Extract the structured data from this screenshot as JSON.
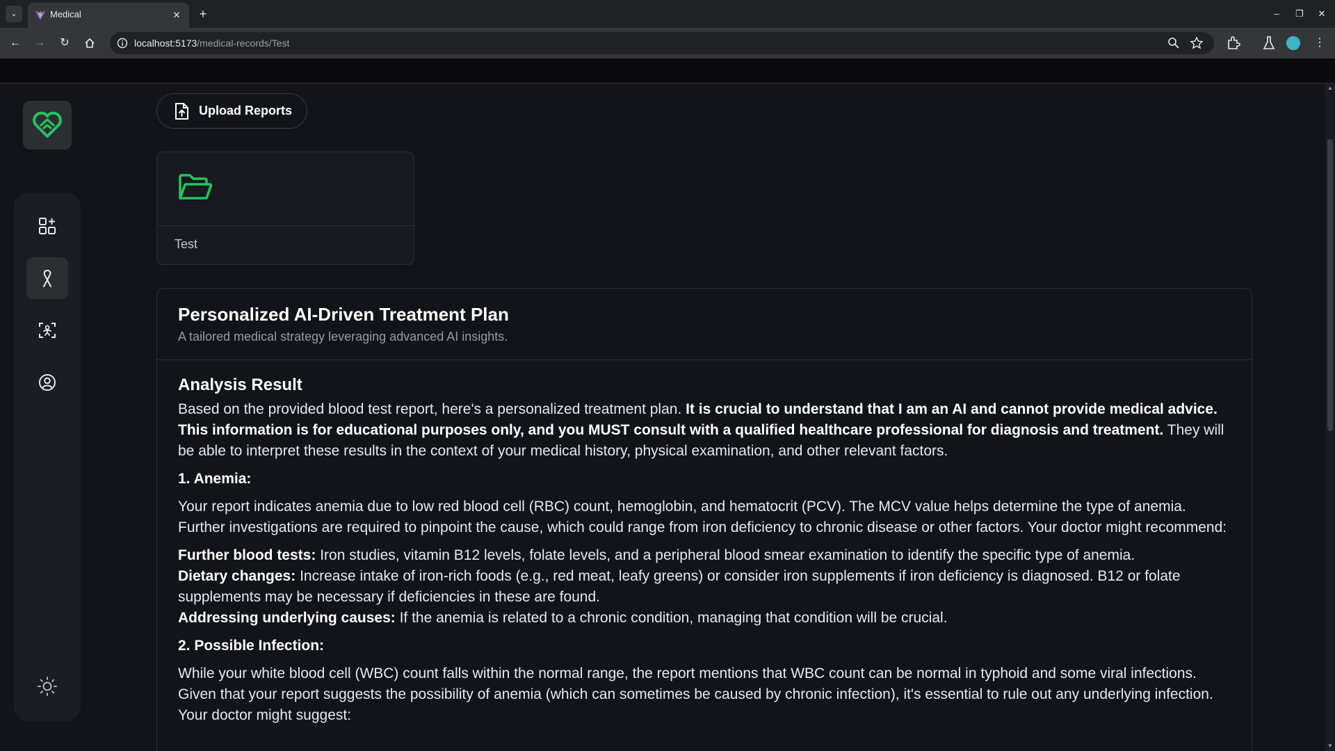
{
  "browser": {
    "tab_title": "Medical",
    "url_host": "localhost:5173",
    "url_path": "/medical-records/Test"
  },
  "sidebar": {
    "items": [
      {
        "icon": "dashboard-grid-icon"
      },
      {
        "icon": "ribbon-icon",
        "active": true
      },
      {
        "icon": "scan-icon"
      },
      {
        "icon": "profile-icon"
      }
    ],
    "theme_toggle_icon": "sun-icon"
  },
  "colors": {
    "accent": "#22c55e",
    "background": "#13131a",
    "panel": "#1c1c24"
  },
  "upload": {
    "label": "Upload Reports"
  },
  "folder": {
    "name": "Test"
  },
  "plan": {
    "title": "Personalized AI-Driven Treatment Plan",
    "subtitle": "A tailored medical strategy leveraging advanced AI insights.",
    "analysis_title": "Analysis Result",
    "intro_plain": "Based on the provided blood test report, here's a personalized treatment plan.",
    "intro_bold": "It is crucial to understand that I am an AI and cannot provide medical advice. This information is for educational purposes only, and you MUST consult with a qualified healthcare professional for diagnosis and treatment.",
    "intro_tail": "They will be able to interpret these results in the context of your medical history, physical examination, and other relevant factors.",
    "section1_title": "1. Anemia:",
    "section1_text": "Your report indicates anemia due to low red blood cell (RBC) count, hemoglobin, and hematocrit (PCV). The MCV value helps determine the type of anemia. Further investigations are required to pinpoint the cause, which could range from iron deficiency to chronic disease or other factors. Your doctor might recommend:",
    "bullets": [
      {
        "label": "Further blood tests:",
        "text": "Iron studies, vitamin B12 levels, folate levels, and a peripheral blood smear examination to identify the specific type of anemia."
      },
      {
        "label": "Dietary changes:",
        "text": "Increase intake of iron-rich foods (e.g., red meat, leafy greens) or consider iron supplements if iron deficiency is diagnosed. B12 or folate supplements may be necessary if deficiencies in these are found."
      },
      {
        "label": "Addressing underlying causes:",
        "text": "If the anemia is related to a chronic condition, managing that condition will be crucial."
      }
    ],
    "section2_title": "2. Possible Infection:",
    "section2_text": "While your white blood cell (WBC) count falls within the normal range, the report mentions that WBC count can be normal in typhoid and some viral infections. Given that your report suggests the possibility of anemia (which can sometimes be caused by chronic infection), it's essential to rule out any underlying infection. Your doctor might suggest:"
  }
}
